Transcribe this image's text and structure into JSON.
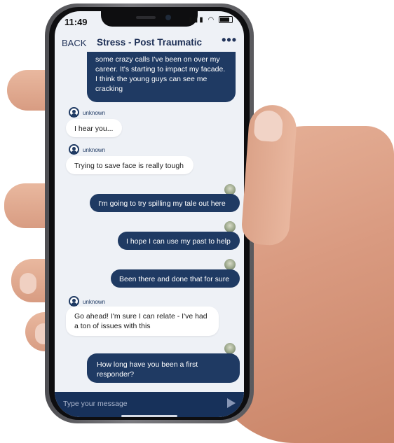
{
  "status": {
    "time": "11:49"
  },
  "nav": {
    "back_label": "BACK",
    "title": "Stress - Post Traumatic",
    "more_label": "•••"
  },
  "messages": [
    {
      "sender": "self",
      "text": "some crazy calls I've been on over my career. It's starting to impact my facade. I think the young guys can see me cracking"
    },
    {
      "sender": "unknown",
      "name": "unknown",
      "text": "I hear you..."
    },
    {
      "sender": "unknown",
      "name": "unknown",
      "text": "Trying to save face is really tough"
    },
    {
      "sender": "self",
      "text": "I'm going to try spilling my tale out here"
    },
    {
      "sender": "self",
      "text": "I hope I can use my past to help"
    },
    {
      "sender": "self",
      "text": "Been there and done that for sure"
    },
    {
      "sender": "unknown",
      "name": "unknown",
      "text": "Go ahead! I'm sure I can relate - I've had a ton of issues with this"
    },
    {
      "sender": "self",
      "text": "How long have you been a first responder?"
    }
  ],
  "composer": {
    "placeholder": "Type your message",
    "value": ""
  },
  "colors": {
    "accent": "#1f3a63",
    "background": "#eef1f6"
  },
  "icons": {
    "send": "send-icon",
    "more": "more-icon",
    "avatar": "avatar-icon"
  }
}
